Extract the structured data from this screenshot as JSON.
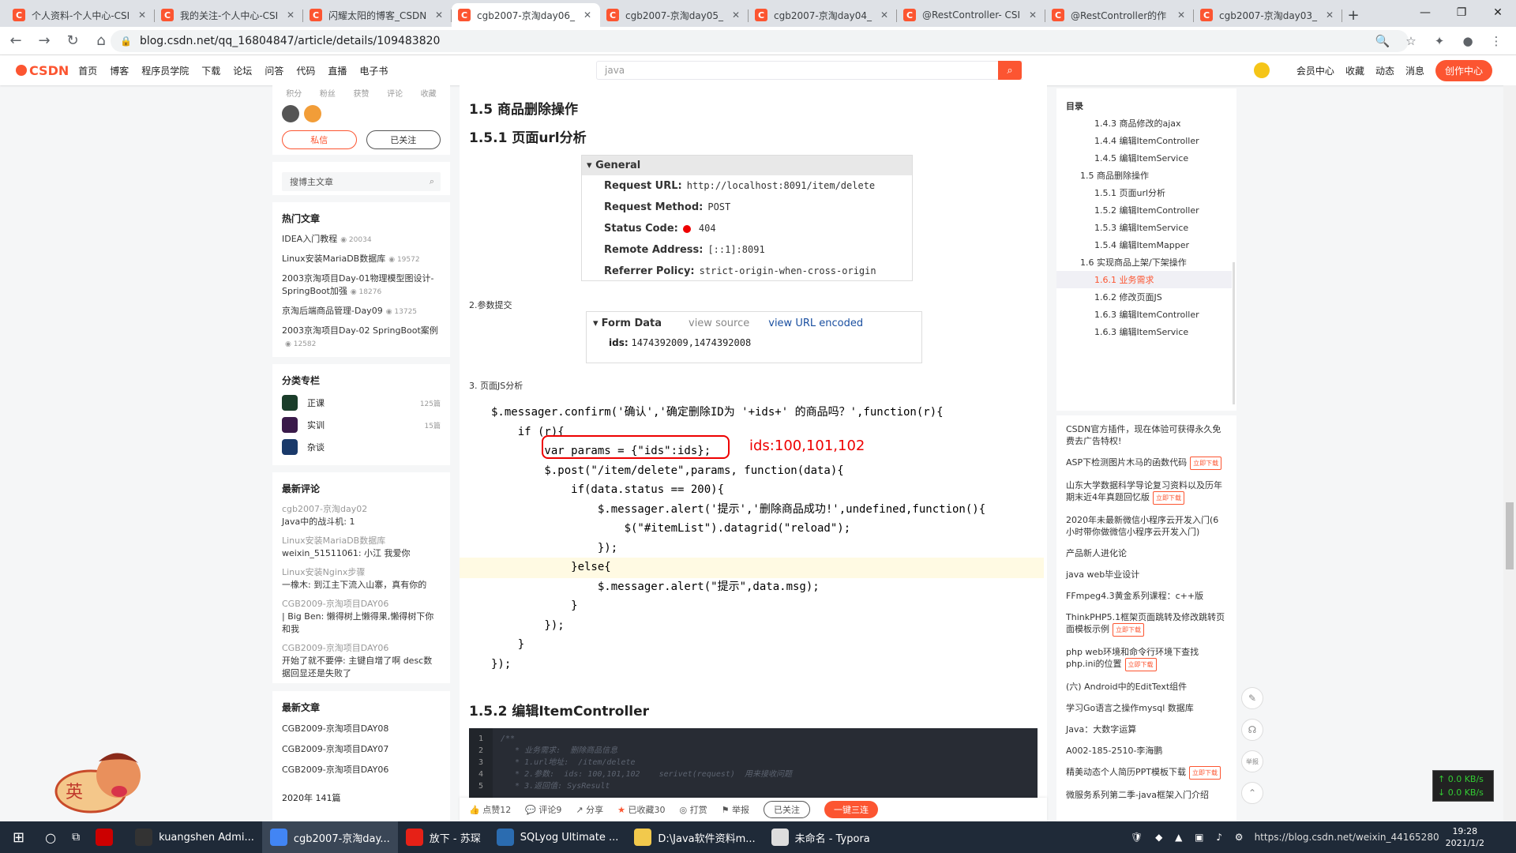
{
  "tabs": [
    {
      "label": "个人资料-个人中心-CSI",
      "active": false
    },
    {
      "label": "我的关注-个人中心-CSI",
      "active": false
    },
    {
      "label": "闪耀太阳的博客_CSDN",
      "active": false
    },
    {
      "label": "cgb2007-京淘day06_",
      "active": true
    },
    {
      "label": "cgb2007-京淘day05_",
      "active": false
    },
    {
      "label": "cgb2007-京淘day04_",
      "active": false
    },
    {
      "label": "@RestController- CSI",
      "active": false
    },
    {
      "label": "@RestController的作",
      "active": false
    },
    {
      "label": "cgb2007-京淘day03_",
      "active": false
    }
  ],
  "address": {
    "url": "blog.csdn.net/qq_16804847/article/details/109483820"
  },
  "csdn": {
    "logo": "CSDN",
    "nav": [
      "首页",
      "博客",
      "程序员学院",
      "下载",
      "论坛",
      "问答",
      "代码",
      "直播",
      "电子书"
    ],
    "search_value": "java",
    "right": [
      "会员中心",
      "收藏",
      "动态",
      "消息"
    ],
    "create": "创作中心"
  },
  "profile": {
    "stats": [
      "积分",
      "粉丝",
      "获赞",
      "评论",
      "收藏"
    ],
    "msg_btn": "私信",
    "follow_btn": "已关注",
    "search_placeholder": "搜博主文章"
  },
  "hot": {
    "title": "热门文章",
    "items": [
      {
        "t": "IDEA入门教程",
        "c": "20034"
      },
      {
        "t": "Linux安装MariaDB数据库",
        "c": "19572"
      },
      {
        "t": "2003京淘项目Day-01物理模型图设计-SpringBoot加强",
        "c": "18276"
      },
      {
        "t": "京淘后端商品管理-Day09",
        "c": "13725"
      },
      {
        "t": "2003京淘项目Day-02 SpringBoot案例",
        "c": "12582"
      }
    ]
  },
  "cats": {
    "title": "分类专栏",
    "items": [
      {
        "t": "正课",
        "c": "125篇"
      },
      {
        "t": "实训",
        "c": "15篇"
      },
      {
        "t": "杂谈",
        "c": ""
      }
    ]
  },
  "comments": {
    "title": "最新评论",
    "items": [
      {
        "a": "cgb2007-京淘day02",
        "b": "Java中的战斗机: 1"
      },
      {
        "a": "Linux安装MariaDB数据库",
        "b": "weixin_51511061: 小江 我爱你"
      },
      {
        "a": "Linux安装Nginx步骤",
        "b": "一橡木: 到江主下流入山寨，真有你的"
      },
      {
        "a": "CGB2009-京淘项目DAY06",
        "b": "| Big Ben: 懒得树上懒得果,懒得树下你和我"
      },
      {
        "a": "CGB2009-京淘项目DAY06",
        "b": "开始了就不要停: 主键自增了啊 desc数据回显还是失败了"
      }
    ]
  },
  "recent": {
    "title": "最新文章",
    "items": [
      "CGB2009-京淘项目DAY08",
      "CGB2009-京淘项目DAY07",
      "CGB2009-京淘项目DAY06"
    ],
    "year": "2020年",
    "year_count": "141篇"
  },
  "article": {
    "h15": "1.5 商品删除操作",
    "h151": "1.5.1 页面url分析",
    "general": {
      "title": "General",
      "rows": [
        {
          "k": "Request URL:",
          "v": "http://localhost:8091/item/delete"
        },
        {
          "k": "Request Method:",
          "v": "POST"
        },
        {
          "k": "Status Code:",
          "v": "404"
        },
        {
          "k": "Remote Address:",
          "v": "[::1]:8091"
        },
        {
          "k": "Referrer Policy:",
          "v": "strict-origin-when-cross-origin"
        }
      ]
    },
    "p2": "2.参数提交",
    "form": {
      "title": "Form Data",
      "src": "view source",
      "enc": "view URL encoded",
      "k": "ids:",
      "v": "1474392009,1474392008"
    },
    "p3": "3. 页面JS分析",
    "code": [
      "$.messager.confirm('确认','确定删除ID为 '+ids+' 的商品吗？',function(r){",
      "    if (r){",
      "        var params = {\"ids\":ids};",
      "        $.post(\"/item/delete\",params, function(data){",
      "            if(data.status == 200){",
      "                $.messager.alert('提示','删除商品成功!',undefined,function(){",
      "                    $(\"#itemList\").datagrid(\"reload\");",
      "                });",
      "            }else{",
      "                $.messager.alert(\"提示\",data.msg);",
      "            }",
      "        });",
      "    }",
      "});"
    ],
    "annotation": "ids:100,101,102",
    "h152": "1.5.2 编辑ItemController",
    "dark_code": [
      "/**",
      "   * 业务需求:  删除商品信息",
      "   * 1.url地址:  /item/delete",
      "   * 2.参数:  ids: 100,101,102    serivet(request)  用来接收问题",
      "   * 3.返回值: SysResult"
    ],
    "dark_lines": [
      "1",
      "2",
      "3",
      "4",
      "5"
    ]
  },
  "toolbar": {
    "like": "点赞12",
    "comment": "评论9",
    "share": "分享",
    "fav": "已收藏30",
    "tip": "打赏",
    "report": "举报",
    "follow": "已关注",
    "triple": "一键三连"
  },
  "toc": {
    "title": "目录",
    "items": [
      {
        "t": "1.4.3 商品修改的ajax",
        "lvl": 2
      },
      {
        "t": "1.4.4 编辑ItemController",
        "lvl": 2
      },
      {
        "t": "1.4.5 编辑ItemService",
        "lvl": 2
      },
      {
        "t": "1.5 商品删除操作",
        "lvl": 1
      },
      {
        "t": "1.5.1 页面url分析",
        "lvl": 2
      },
      {
        "t": "1.5.2 编辑ItemController",
        "lvl": 2
      },
      {
        "t": "1.5.3 编辑ItemService",
        "lvl": 2
      },
      {
        "t": "1.5.4 编辑ItemMapper",
        "lvl": 2
      },
      {
        "t": "1.6 实现商品上架/下架操作",
        "lvl": 1
      },
      {
        "t": "1.6.1 业务需求",
        "lvl": 2,
        "active": true
      },
      {
        "t": "1.6.2 修改页面JS",
        "lvl": 2
      },
      {
        "t": "1.6.3 编辑ItemController",
        "lvl": 2
      },
      {
        "t": "1.6.3 编辑ItemService",
        "lvl": 2
      }
    ]
  },
  "rec": [
    {
      "t": "CSDN官方插件，现在体验可获得永久免费去广告特权!",
      "dl": false
    },
    {
      "t": "ASP下检测图片木马的函数代码",
      "dl": true
    },
    {
      "t": "山东大学数据科学导论复习资料以及历年期末近4年真题回忆版",
      "dl": true
    },
    {
      "t": "2020年未最新微信小程序云开发入门(6小时带你做微信小程序云开发入门)",
      "dl": false
    },
    {
      "t": "产品新人进化论",
      "dl": false
    },
    {
      "t": "java web毕业设计",
      "dl": false
    },
    {
      "t": "FFmpeg4.3黄金系列课程：c++版",
      "dl": false
    },
    {
      "t": "ThinkPHP5.1框架页面跳转及修改跳转页面模板示例",
      "dl": true
    },
    {
      "t": "php web环境和命令行环境下查找php.ini的位置",
      "dl": true
    },
    {
      "t": "(六) Android中的EditText组件",
      "dl": false
    },
    {
      "t": "学习Go语言之操作mysql 数据库",
      "dl": false
    },
    {
      "t": "Java：大数字运算",
      "dl": false
    },
    {
      "t": "A002-185-2510-李海鹏",
      "dl": false
    },
    {
      "t": "精美动态个人简历PPT模板下载",
      "dl": true
    },
    {
      "t": "微服务系列第二季-java框架入门介绍",
      "dl": false
    }
  ],
  "dl_label": "立即下载",
  "net": {
    "up": "↑ 0.0 KB/s",
    "down": "↓ 0.0 KB/s"
  },
  "taskbar": [
    {
      "t": "",
      "c": "#c00"
    },
    {
      "t": "kuangshen Admi...",
      "c": "#333"
    },
    {
      "t": "cgb2007-京淘day...",
      "c": "#4285f4",
      "on": true
    },
    {
      "t": "放下 - 苏琛",
      "c": "#e62117"
    },
    {
      "t": "SQLyog Ultimate ...",
      "c": "#2b6cb0"
    },
    {
      "t": "D:\\Java软件资料m...",
      "c": "#f2c94c"
    },
    {
      "t": "未命名 - Typora",
      "c": "#ddd"
    }
  ],
  "tray": {
    "url": "https://blog.csdn.net/weixin_44165280",
    "time": "19:28",
    "date": "2021/1/2"
  }
}
